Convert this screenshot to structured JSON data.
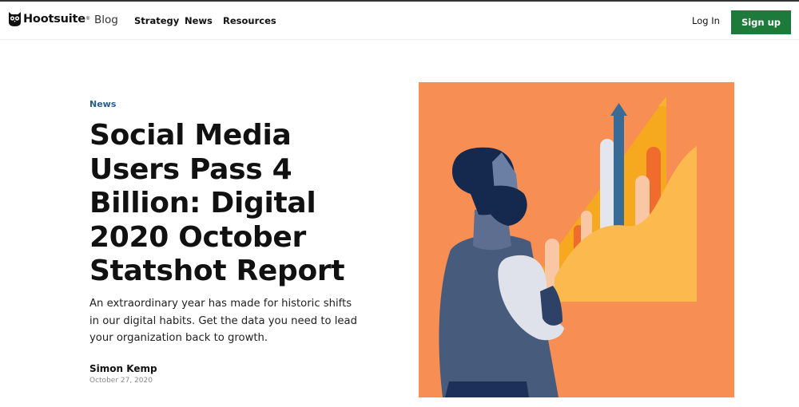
{
  "nav": {
    "logo_text": "Hootsuite",
    "logo_tm": "®",
    "blog": "Blog",
    "links": [
      "Strategy",
      "News",
      "Resources"
    ],
    "login": "Log In",
    "signup": "Sign up",
    "signup_color": "#1e7a3a"
  },
  "article": {
    "category": "News",
    "category_color": "#2b5d8c",
    "title": "Social Media Users Pass 4 Billion: Digital 2020 October Statshot Report",
    "subtitle": "An extraordinary year has made for historic shifts in our digital habits. Get the data you need to lead your organization back to growth.",
    "author": "Simon Kemp",
    "date": "October 27, 2020"
  },
  "hero": {
    "description": "illustration",
    "background_color": "#f78f54"
  }
}
